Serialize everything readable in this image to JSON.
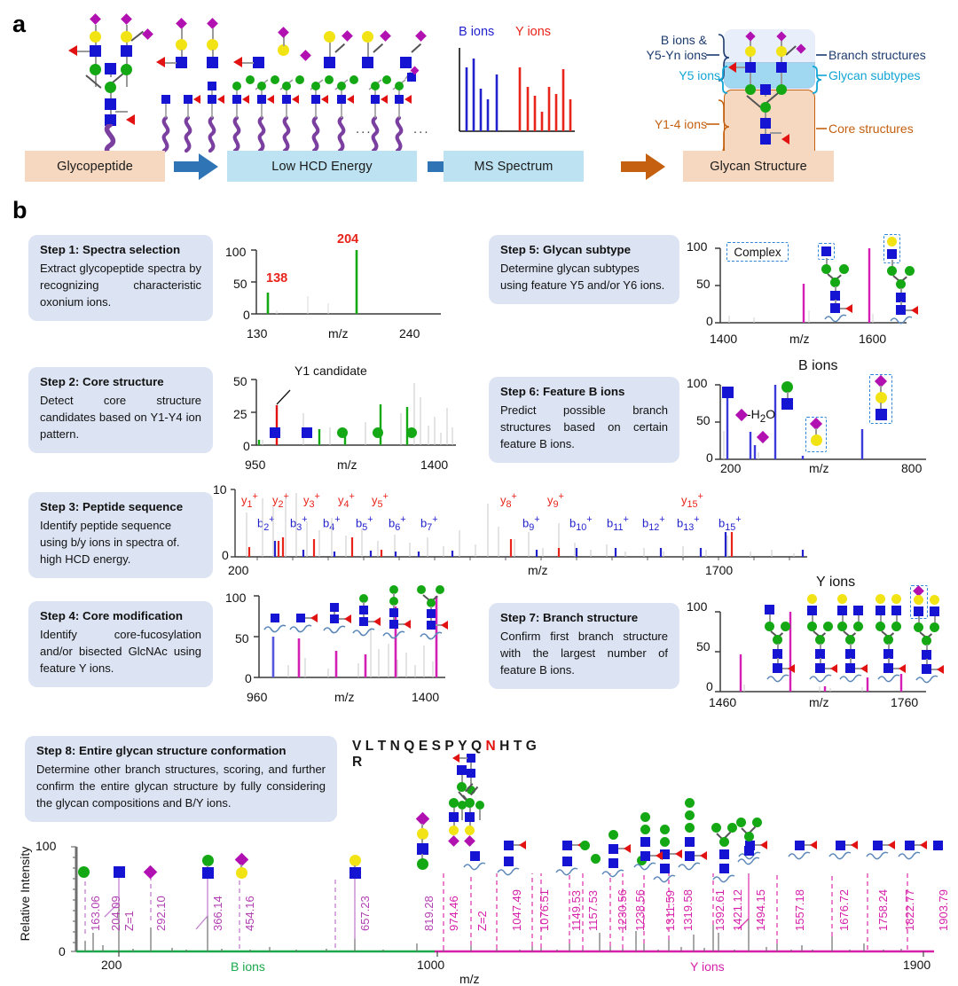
{
  "figure": {
    "panel_a_letter": "a",
    "panel_b_letter": "b"
  },
  "panel_a": {
    "boxes": [
      {
        "label": "Glycopeptide",
        "style": "peach"
      },
      {
        "label": "Low HCD Energy",
        "style": "blue"
      },
      {
        "label": "MS Spectrum",
        "style": "blue"
      },
      {
        "label": "Glycan Structure",
        "style": "peach"
      }
    ],
    "spectrum_legend": {
      "b_ions": "B ions",
      "y_ions": "Y ions"
    },
    "annotations": {
      "left_top": "B ions &",
      "left_top2": "Y5-Yn ions",
      "left_mid": "Y5 ions",
      "left_bottom": "Y1-4 ions",
      "right_top": "Branch structures",
      "right_mid": "Glycan subtypes",
      "right_bottom": "Core structures"
    },
    "colors": {
      "peach": "#f6d8c0",
      "blue": "#bde3f2",
      "arrow_blue": "#2f74b5",
      "arrow_orange": "#c4600f",
      "b_ion": "#2222cc",
      "y_ion": "#e8231a"
    }
  },
  "steps": [
    {
      "id": "step1",
      "title": "Step 1: Spectra selection",
      "body": "Extract glycopeptide spectra by recognizing characteristic oxonium ions.",
      "chart_data": {
        "type": "bar",
        "title": "",
        "xlabel": "m/z",
        "ylabel": "",
        "xticks": [
          "130",
          "240"
        ],
        "yticks": [
          "0",
          "50",
          "100"
        ],
        "ylim": [
          0,
          100
        ],
        "xlim": [
          130,
          240
        ],
        "annotations": [
          "138",
          "204"
        ],
        "series": [
          {
            "name": "oxonium ions",
            "color": "#14a814",
            "x": [
              138,
              204
            ],
            "values": [
              34,
              100
            ]
          }
        ]
      }
    },
    {
      "id": "step2",
      "title": "Step 2: Core structure",
      "body": "Detect core structure candidates based on Y1-Y4 ion pattern.",
      "chart_data": {
        "type": "bar",
        "xlabel": "m/z",
        "xticks": [
          "950",
          "1400"
        ],
        "yticks": [
          "0",
          "25",
          "50"
        ],
        "ylim": [
          0,
          50
        ],
        "xlim": [
          950,
          1400
        ],
        "annotations": [
          "Y1 candidate"
        ],
        "series": [
          {
            "name": "Y1 candidate",
            "color": "#e21212",
            "x": [
              970
            ],
            "values": [
              26
            ]
          },
          {
            "name": "Y ions",
            "color": "#14a814",
            "x": [
              952,
              1065,
              1130,
              1250,
              1330
            ],
            "values": [
              4,
              13,
              10,
              32,
              30
            ]
          }
        ]
      }
    },
    {
      "id": "step3",
      "title": "Step 3: Peptide sequence",
      "body": "Identify peptide sequence using b/y ions in spectra of. high HCD energy.",
      "chart_data": {
        "type": "bar",
        "xlabel": "m/z",
        "xticks": [
          "200",
          "1700"
        ],
        "yticks": [
          "0",
          "10"
        ],
        "ylim": [
          0,
          10
        ],
        "xlim": [
          200,
          1700
        ],
        "y_ion_labels": [
          "y1+",
          "y2+",
          "y3+",
          "y4+",
          "y5+",
          "y8+",
          "y9+",
          "y15+"
        ],
        "b_ion_labels": [
          "b2+",
          "b3+",
          "b4+",
          "b5+",
          "b6+",
          "b7+",
          "b9+",
          "b10+",
          "b11+",
          "b12+",
          "b13+",
          "b15+"
        ]
      }
    },
    {
      "id": "step4",
      "title": "Step 4: Core modification",
      "body": "Identify core-fucosylation and/or bisected GlcNAc using feature Y ions.",
      "chart_data": {
        "type": "bar",
        "xlabel": "m/z",
        "xticks": [
          "960",
          "1400"
        ],
        "yticks": [
          "0",
          "50",
          "100"
        ],
        "ylim": [
          0,
          100
        ],
        "xlim": [
          960,
          1400
        ],
        "series": [
          {
            "name": "Y1",
            "color": "#5555dd",
            "x": [
              975
            ],
            "values": [
              50
            ]
          },
          {
            "name": "feature Y ions",
            "color": "#d41fb4",
            "x": [
              1045,
              1155,
              1215,
              1300,
              1385
            ],
            "values": [
              47,
              31,
              27,
              87,
              100
            ]
          }
        ]
      }
    },
    {
      "id": "step5",
      "title": "Step 5: Glycan subtype",
      "body": "Determine glycan subtypes using feature Y5 and/or Y6 ions.",
      "chart_data": {
        "type": "bar",
        "xlabel": "m/z",
        "xticks": [
          "1400",
          "1600"
        ],
        "yticks": [
          "0",
          "50",
          "100"
        ],
        "ylim": [
          0,
          100
        ],
        "xlim": [
          1400,
          1650
        ],
        "annotations": [
          "Complex"
        ],
        "series": [
          {
            "name": "Y5",
            "color": "#d41fb4",
            "x": [
              1513
            ],
            "values": [
              54
            ]
          },
          {
            "name": "Y6",
            "color": "#d41fb4",
            "x": [
              1607
            ],
            "values": [
              100
            ]
          }
        ]
      }
    },
    {
      "id": "step6",
      "title": "Step 6: Feature B ions",
      "body": "Predict possible branch structures based on certain feature B ions.",
      "chart_data": {
        "type": "bar",
        "xlabel": "m/z",
        "xticks": [
          "200",
          "800"
        ],
        "yticks": [
          "0",
          "50",
          "100"
        ],
        "ylim": [
          0,
          100
        ],
        "xlim": [
          200,
          800
        ],
        "annotations": [
          "B ions",
          "-H2O"
        ],
        "series": [
          {
            "name": "B ions",
            "color": "#3b3bdc",
            "x": [
              215,
              280,
              300,
              366,
              454,
              657
            ],
            "values": [
              82,
              37,
              20,
              100,
              5,
              40
            ]
          }
        ]
      }
    },
    {
      "id": "step7",
      "title": "Step 7: Branch structure",
      "body": "Confirm first branch structure with the largest number of  feature B ions.",
      "chart_data": {
        "type": "bar",
        "xlabel": "m/z",
        "xticks": [
          "1460",
          "1760"
        ],
        "yticks": [
          "0",
          "50",
          "100"
        ],
        "ylim": [
          0,
          100
        ],
        "xlim": [
          1460,
          1790
        ],
        "annotations": [
          "Y ions"
        ],
        "series": [
          {
            "name": "Y ions",
            "color": "#d41fb4",
            "x": [
              1494,
              1557,
              1676,
              1758,
              1790
            ],
            "values": [
              47,
              100,
              7,
              17,
              22
            ]
          }
        ]
      }
    },
    {
      "id": "step8",
      "title": "Step 8: Entire glycan structure conformation",
      "body": "Determine other branch structures, scoring, and further confirm the entire glycan structure by fully considering the glycan compositions and B/Y ions."
    }
  ],
  "peptide": {
    "sequence": [
      "V",
      "L",
      "T",
      "N",
      "Q",
      "E",
      "S",
      "P",
      "Y",
      "Q",
      "N",
      "H",
      "T",
      "G",
      "R"
    ],
    "modified_index": 10,
    "modified_color": "#e21212"
  },
  "main_spectrum": {
    "ylabel": "Relative Intensity",
    "xlabel": "m/z",
    "yticks": [
      "0",
      "100"
    ],
    "xticks": [
      "200",
      "1000",
      "1900"
    ],
    "region_labels": {
      "b": "B ions",
      "y": "Y ions"
    },
    "region_colors": {
      "b": "#1aa84a",
      "y": "#d61fa8"
    },
    "chart_data": {
      "type": "bar",
      "title": "",
      "xlabel": "m/z",
      "ylabel": "Relative Intensity",
      "xlim": [
        120,
        1960
      ],
      "ylim": [
        0,
        100
      ],
      "b_ions": [
        {
          "mz": "163.06",
          "charge": "",
          "x": 163.06,
          "intensity": 18
        },
        {
          "mz": "",
          "charge": "Z=1",
          "x": 186.0,
          "intensity": 7
        },
        {
          "mz": "204.09",
          "charge": "",
          "x": 204.09,
          "intensity": 47
        },
        {
          "mz": "292.10",
          "charge": "",
          "x": 292.1,
          "intensity": 22
        },
        {
          "mz": "366.14",
          "charge": "",
          "x": 366.14,
          "intensity": 33
        },
        {
          "mz": "454.16",
          "charge": "",
          "x": 454.16,
          "intensity": 3
        },
        {
          "mz": "657.23",
          "charge": "",
          "x": 657.23,
          "intensity": 9
        },
        {
          "mz": "819.28",
          "charge": "",
          "x": 819.28,
          "intensity": 5
        }
      ],
      "y_ions": [
        {
          "mz": "974.46",
          "charge": "Z=2",
          "x": 974.46,
          "intensity": 5
        },
        {
          "mz": "1047.49",
          "charge": "",
          "x": 1047.49,
          "intensity": 4
        },
        {
          "mz": "1076.51",
          "charge": "",
          "x": 1076.51,
          "intensity": 4
        },
        {
          "mz": "1149.53",
          "charge": "",
          "x": 1149.53,
          "intensity": 3
        },
        {
          "mz": "1157.53",
          "charge": "",
          "x": 1157.53,
          "intensity": 3
        },
        {
          "mz": "1230.56",
          "charge": "",
          "x": 1230.56,
          "intensity": 3
        },
        {
          "mz": "1238.56",
          "charge": "",
          "x": 1238.56,
          "intensity": 9
        },
        {
          "mz": "1311.59",
          "charge": "",
          "x": 1311.59,
          "intensity": 13
        },
        {
          "mz": "1319.58",
          "charge": "",
          "x": 1319.58,
          "intensity": 10
        },
        {
          "mz": "1392.61",
          "charge": "",
          "x": 1392.61,
          "intensity": 6
        },
        {
          "mz": "1421.12",
          "charge": "",
          "x": 1421.12,
          "intensity": 7
        },
        {
          "mz": "1494.15",
          "charge": "",
          "x": 1494.15,
          "intensity": 30
        },
        {
          "mz": "1557.18",
          "charge": "",
          "x": 1557.18,
          "intensity": 33
        },
        {
          "mz": "1676.72",
          "charge": "",
          "x": 1676.72,
          "intensity": 8
        },
        {
          "mz": "1758.24",
          "charge": "",
          "x": 1758.24,
          "intensity": 5
        },
        {
          "mz": "1822.77",
          "charge": "",
          "x": 1822.77,
          "intensity": 2
        },
        {
          "mz": "1903.79",
          "charge": "",
          "x": 1903.79,
          "intensity": 2
        }
      ]
    }
  },
  "glycan_legend": {
    "glcnac": "blue-square",
    "mannose": "green-circle",
    "galactose": "yellow-circle",
    "neuac": "purple-diamond",
    "fucose": "red-triangle",
    "peptide": "purple-wave"
  }
}
